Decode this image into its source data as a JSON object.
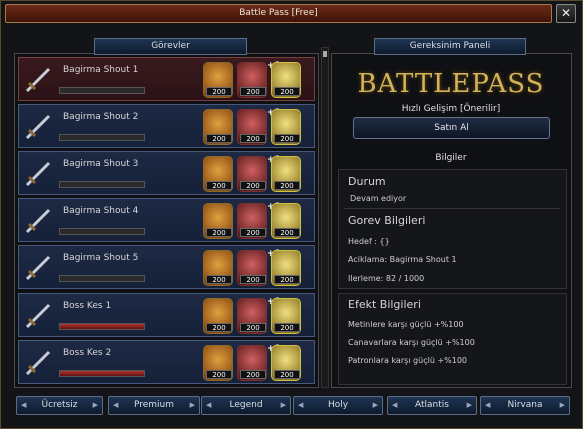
{
  "window": {
    "title": "Battle Pass [Free]",
    "close_glyph": "✕"
  },
  "left_panel": {
    "label": "Görevler"
  },
  "right_panel": {
    "label": "Gereksinim Paneli"
  },
  "quests": [
    {
      "name": "Bagirma Shout 1",
      "progress": 0.0,
      "active": true
    },
    {
      "name": "Bagirma Shout 2",
      "progress": 0.0
    },
    {
      "name": "Bagirma Shout 3",
      "progress": 0.0
    },
    {
      "name": "Bagirma Shout 4",
      "progress": 0.0
    },
    {
      "name": "Bagirma Shout 5",
      "progress": 0.0
    },
    {
      "name": "Boss Kes 1",
      "progress": 1.0
    },
    {
      "name": "Boss Kes 2",
      "progress": 1.0
    }
  ],
  "rewards": {
    "count": "200",
    "plus": "+1",
    "icons": [
      "scroll-reward-icon",
      "orb-reward-icon",
      "star-reward-icon"
    ]
  },
  "battlepass": {
    "logo": "BATTLEPASS",
    "subtitle": "Hızlı Gelişim [Önerilir]",
    "buy_label": "Satın Al",
    "info_heading": "Bilgiler",
    "durum_title": "Durum",
    "durum_value": "Devam ediyor",
    "gorev_title": "Gorev Bilgileri",
    "hedef": "Hedef : {}",
    "aciklama": "Aciklama: Bagirma Shout 1",
    "ilerleme": "Ilerleme: 82 / 1000",
    "efekt_title": "Efekt Bilgileri",
    "effects": [
      "Metinlere karşı güçlü +%100",
      "Canavarlara karşı güçlü +%100",
      "Patronlara karşı güçlü +%100"
    ]
  },
  "tabs": [
    "Ücretsiz",
    "Premium",
    "Legend",
    "Holy",
    "Atlantis",
    "Nirvana"
  ],
  "colors": {
    "accent_gold": "#d2b25a",
    "tab_bg": "#1f3553",
    "bar_red": "#a33333"
  }
}
